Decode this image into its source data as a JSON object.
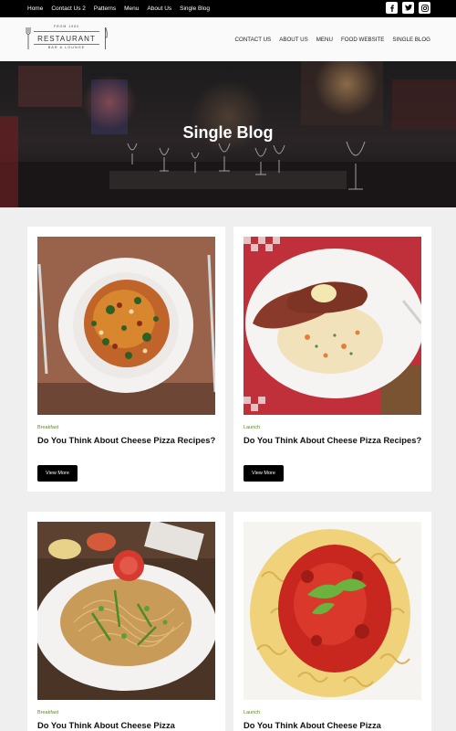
{
  "topbar": {
    "nav": [
      "Home",
      "Contact Us 2",
      "Patterns",
      "Menu",
      "About Us",
      "Single Blog"
    ],
    "social": [
      "facebook-icon",
      "twitter-icon",
      "instagram-icon"
    ]
  },
  "logo": {
    "small": "FROM 1950",
    "main": "RESTAURANT",
    "sub": "BAR & LOUNGE"
  },
  "mainnav": [
    "CONTACT US",
    "ABOUT US",
    "MENU",
    "FOOD WEBSITE",
    "SINGLE BLOG"
  ],
  "hero": {
    "title": "Single Blog"
  },
  "posts": [
    {
      "category": "Breakfast",
      "title": "Do You Think About Cheese Pizza Recipes?",
      "button": "View More"
    },
    {
      "category": "Launch",
      "title": "Do You Think About Cheese Pizza Recipes?",
      "button": "View More"
    },
    {
      "category": "Breakfast",
      "title": "Do You Think About Cheese Pizza"
    },
    {
      "category": "Launch",
      "title": "Do You Think About Cheese Pizza"
    }
  ],
  "colors": {
    "accent_category": "#5b8a2a",
    "topbar": "#000000",
    "page_bg": "#efefef"
  }
}
